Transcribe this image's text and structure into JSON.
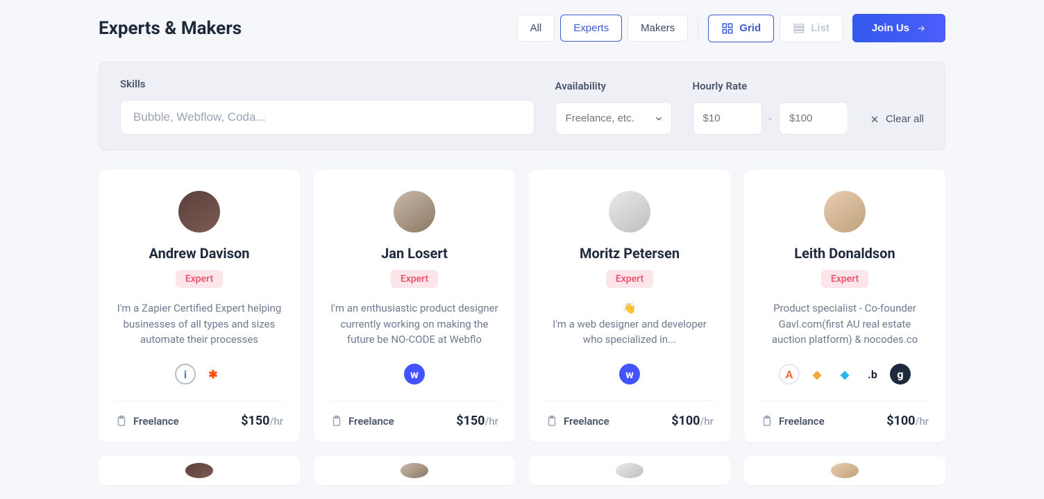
{
  "header": {
    "title": "Experts & Makers",
    "tabs": [
      {
        "label": "All",
        "active": false
      },
      {
        "label": "Experts",
        "active": true
      },
      {
        "label": "Makers",
        "active": false
      }
    ],
    "views": {
      "grid_label": "Grid",
      "list_label": "List"
    },
    "join_label": "Join Us"
  },
  "filters": {
    "skills_label": "Skills",
    "skills_placeholder": "Bubble, Webflow, Coda...",
    "availability_label": "Availability",
    "availability_placeholder": "Freelance, etc.",
    "rate_label": "Hourly Rate",
    "rate_min_placeholder": "$10",
    "rate_max_placeholder": "$100",
    "rate_dash": "-",
    "clear_label": "Clear all"
  },
  "cards": [
    {
      "name": "Andrew Davison",
      "badge": "Expert",
      "bio": "I'm a Zapier Certified Expert helping businesses of all types and sizes automate their processes",
      "availability": "Freelance",
      "rate": "$150",
      "per": "/hr",
      "tools": [
        {
          "name": "integromat-icon",
          "bg": "#fff",
          "border": "#b7bec9",
          "letter": "i",
          "fg": "#3a7bd5"
        },
        {
          "name": "zapier-icon",
          "bg": "#fff",
          "border": "transparent",
          "letter": "✱",
          "fg": "#ff4f00"
        }
      ]
    },
    {
      "name": "Jan Losert",
      "badge": "Expert",
      "bio": "I'm an enthusiastic product designer currently working on making the future be NO-CODE at Webflo",
      "availability": "Freelance",
      "rate": "$150",
      "per": "/hr",
      "tools": [
        {
          "name": "webflow-icon",
          "bg": "#4353ff",
          "border": "transparent",
          "letter": "w",
          "fg": "#fff"
        }
      ]
    },
    {
      "name": "Moritz Petersen",
      "badge": "Expert",
      "bio": "👋\nI'm a web designer and developer who specialized in...",
      "availability": "Freelance",
      "rate": "$100",
      "per": "/hr",
      "tools": [
        {
          "name": "webflow-icon",
          "bg": "#4353ff",
          "border": "transparent",
          "letter": "w",
          "fg": "#fff"
        }
      ]
    },
    {
      "name": "Leith Donaldson",
      "badge": "Expert",
      "bio": "Product specialist - Co-founder Gavl.com(first AU real estate auction platform) & nocodes.co",
      "availability": "Freelance",
      "rate": "$100",
      "per": "/hr",
      "tools": [
        {
          "name": "tool-icon-1",
          "bg": "#fff",
          "border": "#e4e7ef",
          "letter": "A",
          "fg": "#f26a3b"
        },
        {
          "name": "tool-icon-2",
          "bg": "#fff",
          "border": "transparent",
          "letter": "◆",
          "fg": "#f2a63b"
        },
        {
          "name": "tool-icon-3",
          "bg": "#fff",
          "border": "transparent",
          "letter": "◆",
          "fg": "#2bb6e8"
        },
        {
          "name": "tool-icon-4",
          "bg": "#fff",
          "border": "transparent",
          "letter": ".b",
          "fg": "#1e2a3b"
        },
        {
          "name": "tool-icon-5",
          "bg": "#1e2a3b",
          "border": "transparent",
          "letter": "g",
          "fg": "#fff"
        }
      ]
    }
  ]
}
